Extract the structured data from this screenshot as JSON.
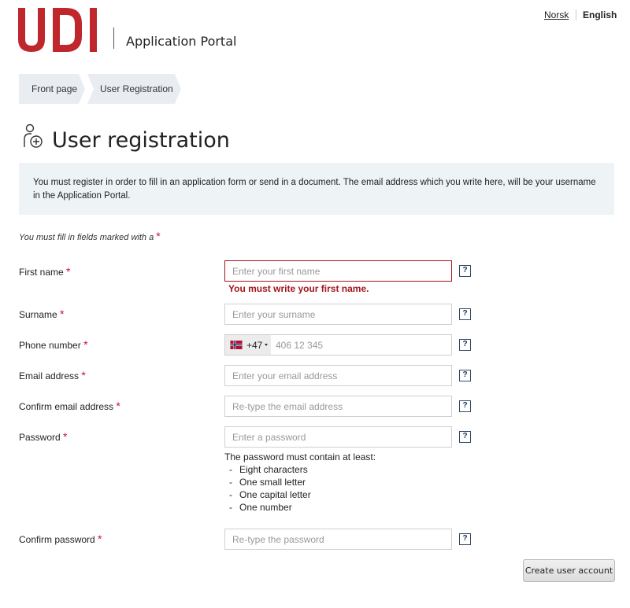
{
  "header": {
    "logo_text": "UDI",
    "portal_title": "Application Portal",
    "brand_color": "#c0272d",
    "languages": [
      {
        "label": "Norsk",
        "active": false
      },
      {
        "label": "English",
        "active": true
      }
    ]
  },
  "breadcrumb": [
    "Front page",
    "User Registration"
  ],
  "page": {
    "title": "User registration",
    "icon": "user-add-icon",
    "info": "You must register in order to fill in an application form or send in a document. The email address which you write here, will be your username in the Application Portal.",
    "required_note": "You must fill in fields marked with a",
    "required_marker": "*"
  },
  "form": {
    "first_name": {
      "label": "First name",
      "placeholder": "Enter your first name",
      "value": "",
      "error": "You must write your first name."
    },
    "surname": {
      "label": "Surname",
      "placeholder": "Enter your surname",
      "value": ""
    },
    "phone": {
      "label": "Phone number",
      "country_code": "+47",
      "country_flag": "norway-flag-icon",
      "placeholder": "406 12 345",
      "value": ""
    },
    "email": {
      "label": "Email address",
      "placeholder": "Enter your email address",
      "value": ""
    },
    "confirm_email": {
      "label": "Confirm email address",
      "placeholder": "Re-type the email address",
      "value": ""
    },
    "password": {
      "label": "Password",
      "placeholder": "Enter a password",
      "value": ""
    },
    "password_rules_title": "The password must contain at least:",
    "password_rules": [
      "Eight characters",
      "One small letter",
      "One capital letter",
      "One number"
    ],
    "confirm_password": {
      "label": "Confirm password",
      "placeholder": "Re-type the password",
      "value": ""
    },
    "help_label": "?",
    "submit_label": "Create user account"
  },
  "colors": {
    "error": "#a4151d",
    "required_star": "#c8102e",
    "info_bg": "#eef3f6",
    "breadcrumb_bg": "#e9edf1"
  }
}
